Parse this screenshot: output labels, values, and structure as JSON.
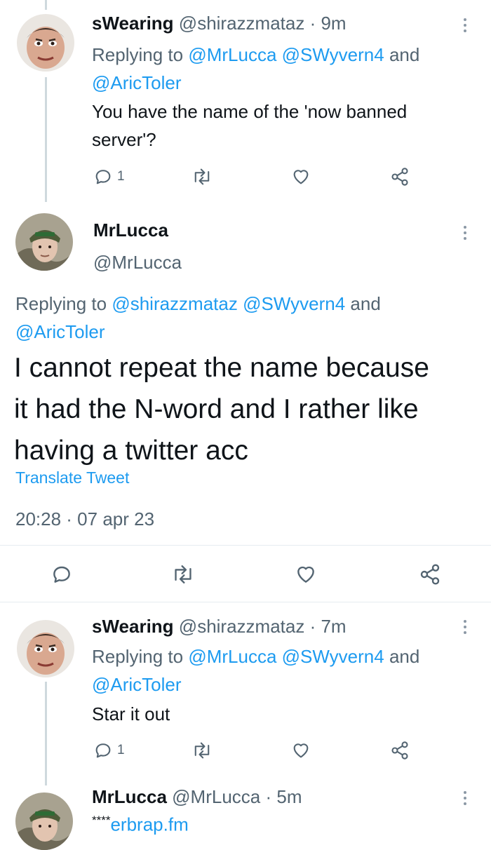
{
  "tweets": [
    {
      "name": "sWearing",
      "handle": "@shirazzmataz",
      "time": "· 9m",
      "reply_prefix": "Replying to ",
      "reply_line1": "@MrLucca @SWyvern4",
      "reply_and": " and",
      "reply_line2": "@AricToler",
      "text_lines": [
        "You have the name of the 'now banned",
        "server'?"
      ],
      "reply_count": "1"
    },
    {
      "name": "MrLucca",
      "handle": "@MrLucca",
      "reply_prefix": "Replying to ",
      "reply_line1": "@shirazzmataz @SWyvern4",
      "reply_and": " and",
      "reply_line2": "@AricToler",
      "text_lines": [
        "I cannot repeat the name because",
        "it had the N-word and I rather like",
        "having a twitter acc"
      ],
      "translate": "Translate Tweet",
      "timestamp": "20:28 · 07 apr 23"
    },
    {
      "name": "sWearing",
      "handle": "@shirazzmataz",
      "time": "· 7m",
      "reply_prefix": "Replying to ",
      "reply_line1": "@MrLucca @SWyvern4",
      "reply_and": " and",
      "reply_line2": "@AricToler",
      "text_lines": [
        "Star it out"
      ],
      "reply_count": "1"
    },
    {
      "name": "MrLucca",
      "handle": "@MrLucca",
      "time": "· 5m",
      "text_stars": "****",
      "text_link": "erbrap.fm"
    }
  ],
  "icons": {
    "reply": "reply-icon",
    "retweet": "retweet-icon",
    "like": "heart-icon",
    "share": "share-icon",
    "more": "more-vertical-icon"
  },
  "colors": {
    "link": "#1d9bf0",
    "secondary": "#536471",
    "text": "#0f1419"
  }
}
